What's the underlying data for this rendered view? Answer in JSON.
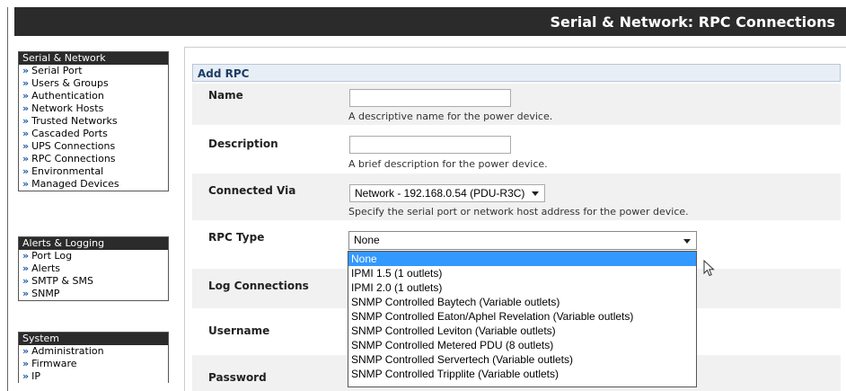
{
  "header": {
    "title": "Serial & Network: RPC Connections"
  },
  "nav": {
    "arrow": "»",
    "serial_network": {
      "title": "Serial & Network",
      "items": [
        "Serial Port",
        "Users & Groups",
        "Authentication",
        "Network Hosts",
        "Trusted Networks",
        "Cascaded Ports",
        "UPS Connections",
        "RPC Connections",
        "Environmental",
        "Managed Devices"
      ]
    },
    "alerts_logging": {
      "title": "Alerts & Logging",
      "items": [
        "Port Log",
        "Alerts",
        "SMTP & SMS",
        "SNMP"
      ]
    },
    "system": {
      "title": "System",
      "items": [
        "Administration",
        "Firmware",
        "IP"
      ]
    }
  },
  "form": {
    "section_title": "Add RPC",
    "name": {
      "label": "Name",
      "value": "",
      "hint": "A descriptive name for the power device."
    },
    "description": {
      "label": "Description",
      "value": "",
      "hint": "A brief description for the power device."
    },
    "connected_via": {
      "label": "Connected Via",
      "value": "Network - 192.168.0.54 (PDU-R3C)",
      "hint": "Specify the serial port or network host address for the power device."
    },
    "rpc_type": {
      "label": "RPC Type",
      "value": "None",
      "options": [
        "None",
        "IPMI 1.5 (1 outlets)",
        "IPMI 2.0 (1 outlets)",
        "SNMP Controlled Baytech (Variable outlets)",
        "SNMP Controlled Eaton/Aphel Revelation (Variable outlets)",
        "SNMP Controlled Leviton (Variable outlets)",
        "SNMP Controlled Metered PDU (8 outlets)",
        "SNMP Controlled Servertech (Variable outlets)",
        "SNMP Controlled Tripplite (Variable outlets)"
      ],
      "highlighted_index": 0
    },
    "log_connections": {
      "label": "Log Connections"
    },
    "username": {
      "label": "Username"
    },
    "password": {
      "label": "Password"
    }
  },
  "colors": {
    "header_bg": "#2b2b2b",
    "nav_arrow": "#1f5aa6",
    "section_title": "#1d3d66",
    "option_highlight": "#3399ff"
  }
}
